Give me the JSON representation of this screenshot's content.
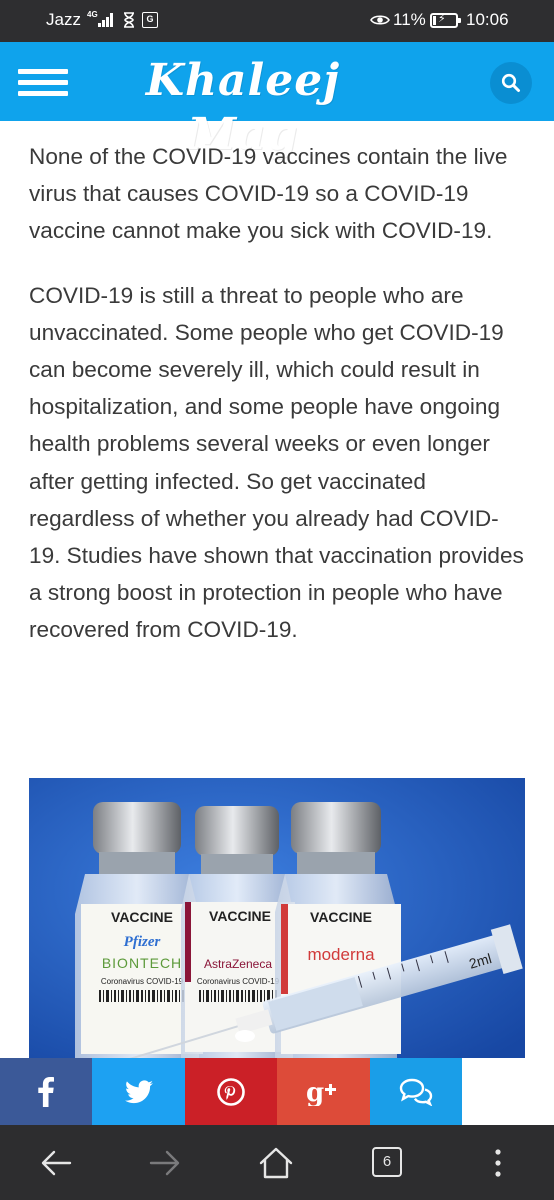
{
  "status_bar": {
    "carrier": "Jazz",
    "network": "4G",
    "battery_percent": "11%",
    "time": "10:06"
  },
  "header": {
    "site_title": "Khaleej Mag",
    "brand_color": "#0fa3ec",
    "menu_icon": "hamburger-menu-icon",
    "search_icon": "search-icon"
  },
  "article": {
    "paragraphs": [
      "None of the COVID-19 vaccines contain the live virus that causes COVID-19 so a COVID-19 vaccine cannot make you sick with COVID-19.",
      "COVID-19 is still a threat to people who are unvaccinated. Some people who get COVID-19 can become severely ill, which could result in hospitalization, and some people have ongoing health problems several weeks or even longer after getting infected. So get vaccinated regardless of whether you already had COVID-19. Studies have shown that vaccination provides a strong boost in protection in people who have recovered from COVID-19."
    ]
  },
  "image": {
    "vial_labels": [
      "VACCINE",
      "VACCINE",
      "VACCINE"
    ],
    "brands": [
      "Pfizer",
      "BIONTECH",
      "AstraZeneca",
      "moderna"
    ],
    "sublabels": [
      "Coronavirus COVID-19",
      "Coronavirus COVID-19"
    ],
    "syringe_label": "2ml"
  },
  "share_bar": {
    "buttons": [
      {
        "name": "facebook",
        "icon": "facebook-icon",
        "color": "#3b5998"
      },
      {
        "name": "twitter",
        "icon": "twitter-icon",
        "color": "#1da1f2"
      },
      {
        "name": "pinterest",
        "icon": "pinterest-icon",
        "color": "#cb2027"
      },
      {
        "name": "google-plus",
        "icon": "google-plus-icon",
        "color": "#dd4b39"
      },
      {
        "name": "messages",
        "icon": "chat-bubbles-icon",
        "color": "#1a9ee8"
      }
    ]
  },
  "browser_nav": {
    "tabs_count": "6",
    "icons": [
      "back-arrow-icon",
      "forward-arrow-icon",
      "home-icon",
      "tabs-icon",
      "more-vertical-icon"
    ]
  }
}
